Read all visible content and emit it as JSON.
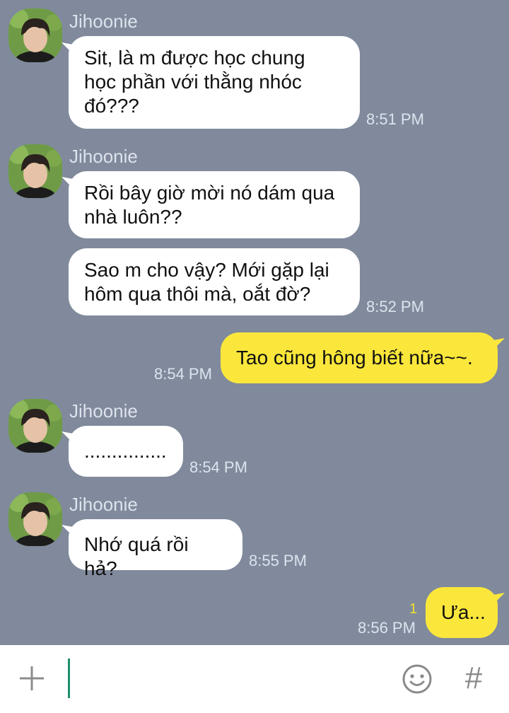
{
  "conversation": {
    "messages": [
      {
        "sender": "Jihoonie",
        "text_lines": [
          "Sit, là m được học chung",
          "học phần với thằng nhóc",
          "đó???"
        ],
        "time": "8:51 PM"
      },
      {
        "sender": "Jihoonie",
        "text_lines": [
          "Rồi bây giờ mời nó dám qua",
          "nhà luôn??"
        ]
      },
      {
        "text_lines": [
          "Sao m cho vậy? Mới gặp lại",
          "hôm qua thôi mà, oắt đờ?"
        ],
        "time": "8:52 PM"
      },
      {
        "text_lines": [
          "Tao cũng hông biết nữa~~."
        ],
        "time": "8:54 PM"
      },
      {
        "sender": "Jihoonie",
        "text_lines": [
          "..............."
        ],
        "time": "8:54 PM"
      },
      {
        "sender": "Jihoonie",
        "text_lines": [
          "Nhớ quá rồi hả?"
        ],
        "time": "8:55 PM"
      },
      {
        "text_lines": [
          "Ưa..."
        ],
        "time": "8:56 PM",
        "unread_count": "1"
      }
    ]
  },
  "input_bar": {
    "add_icon": "plus-icon",
    "emoji_icon": "smiley-icon",
    "hashtag_label": "#"
  },
  "colors": {
    "chat_background": "#808a9c",
    "incoming_bubble": "#ffffff",
    "outgoing_bubble": "#fbe73b",
    "cursor": "#1e8f6e"
  }
}
